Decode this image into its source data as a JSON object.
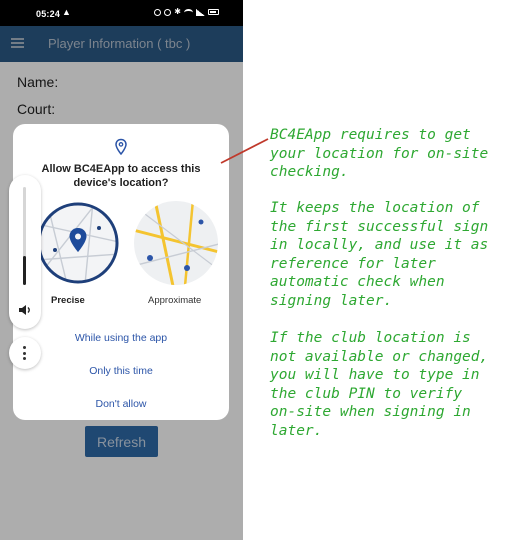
{
  "status_bar": {
    "time": "05:24",
    "alert_glyph": "▲"
  },
  "app_bar": {
    "title": "Player Information ( tbc )"
  },
  "form": {
    "name_label": "Name:",
    "court_label": "Court:",
    "refresh_label": "Refresh"
  },
  "dialog": {
    "title": "Allow BC4EApp to access this device's location?",
    "precise_label": "Precise",
    "approximate_label": "Approximate",
    "selected_option": "Precise",
    "buttons": [
      "While using the app",
      "Only this time",
      "Don't allow"
    ]
  },
  "volume": {
    "level_fraction": 0.3
  },
  "annotation": {
    "color": "#2ea832",
    "paragraphs": [
      "BC4EApp requires to get\nyour location for on-site\nchecking.",
      "It keeps the location of\nthe first successful sign\nin locally, and use it as\nreference for later\nautomatic check when\nsigning later.",
      "If the club location is\nnot available or changed,\nyou will have to type in\nthe club PIN to verify\non-site when signing in\nlater."
    ]
  },
  "colors": {
    "app_bar": "#2b5a86",
    "dialog_button_text": "#2c55a8",
    "pointer_line": "#c0392b",
    "precise_ring": "#1e3f7a"
  },
  "icons": [
    "menu-icon",
    "location-pin-icon",
    "speaker-icon",
    "more-vert-icon"
  ]
}
